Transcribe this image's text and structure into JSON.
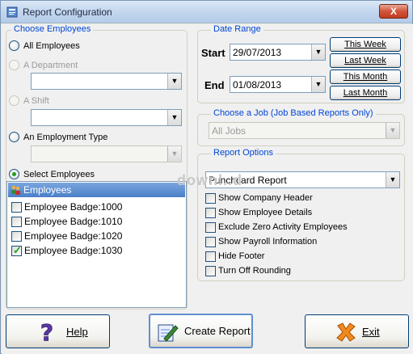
{
  "window": {
    "title": "Report Configuration",
    "close_label": "X"
  },
  "employees_group": {
    "legend": "Choose Employees",
    "options": {
      "all": "All Employees",
      "department": "A Department",
      "shift": "A Shift",
      "employment_type": "An Employment Type",
      "select": "Select Employees"
    },
    "list_header": "Employees",
    "items": [
      {
        "label": "Employee Badge:1000",
        "checked": false
      },
      {
        "label": "Employee Badge:1010",
        "checked": false
      },
      {
        "label": "Employee Badge:1020",
        "checked": false
      },
      {
        "label": "Employee Badge:1030",
        "checked": true
      }
    ]
  },
  "date_range": {
    "legend": "Date Range",
    "start_label": "Start",
    "start_value": "29/07/2013",
    "end_label": "End",
    "end_value": "01/08/2013",
    "buttons": [
      "This Week",
      "Last Week",
      "This Month",
      "Last Month"
    ]
  },
  "job": {
    "legend": "Choose a Job (Job Based Reports Only)",
    "value": "All Jobs"
  },
  "report_options": {
    "legend": "Report Options",
    "report_type": "Punchcard Report",
    "options": [
      "Show Company Header",
      "Show Employee Details",
      "Exclude Zero Activity Employees",
      "Show Payroll Information",
      "Hide Footer",
      "Turn Off Rounding"
    ]
  },
  "footer": {
    "help": "Help",
    "create": "Create Report",
    "exit": "Exit"
  },
  "watermark": "downl..d"
}
